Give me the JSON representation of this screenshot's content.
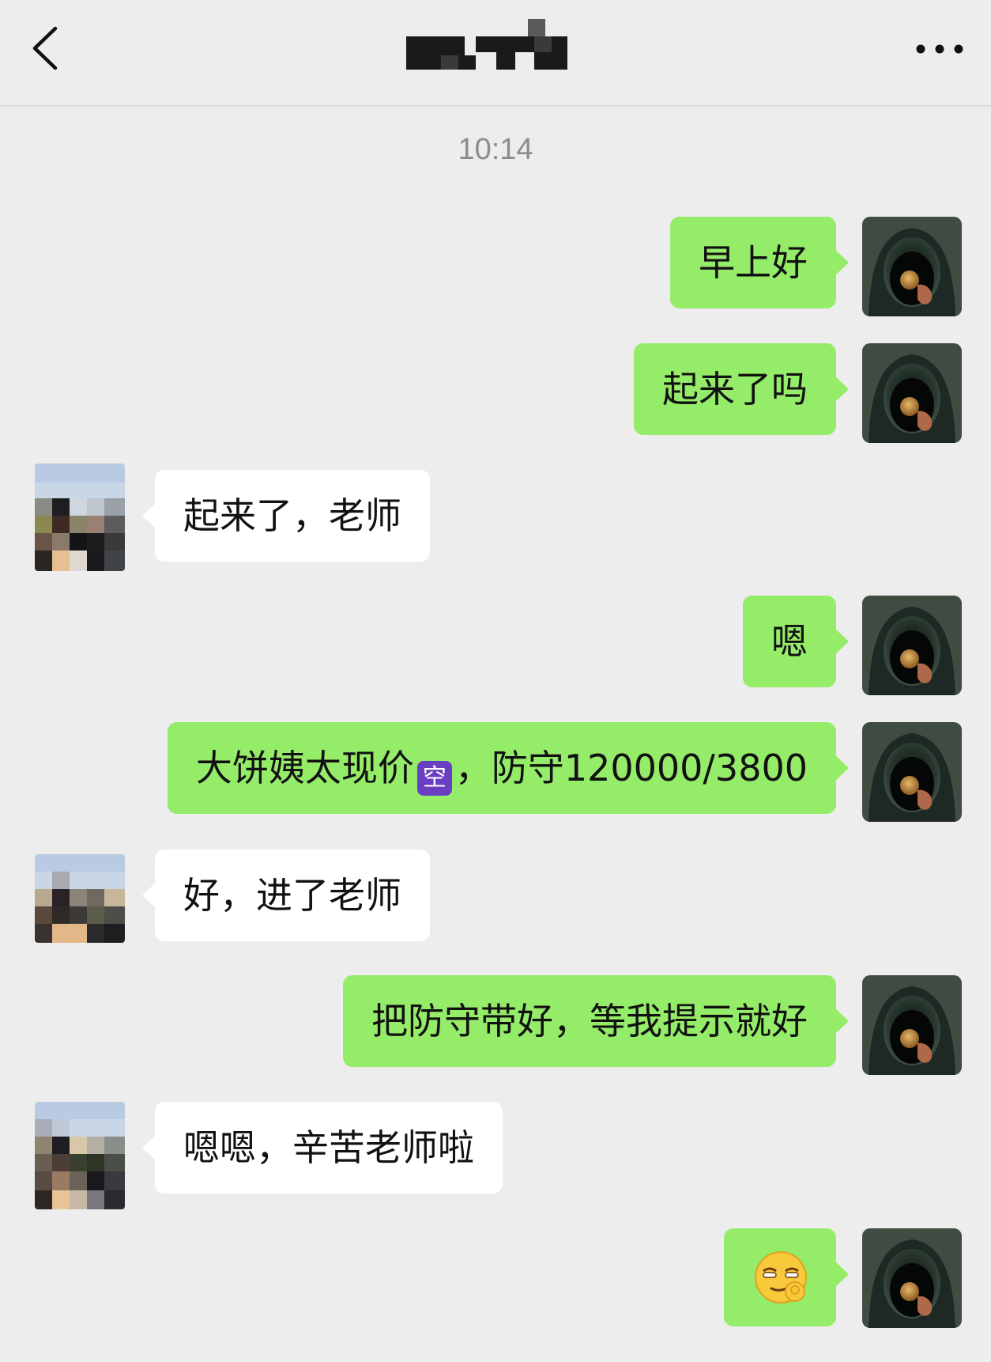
{
  "header": {
    "title_hidden": true
  },
  "chat": {
    "timestamp": "10:14",
    "messages": [
      {
        "side": "self",
        "text": "早上好"
      },
      {
        "side": "self",
        "text": "起来了吗"
      },
      {
        "side": "other",
        "text": "起来了，老师"
      },
      {
        "side": "self",
        "text": "嗯"
      },
      {
        "side": "self",
        "text_before": "大饼姨太现价",
        "badge": "空",
        "text_after": "，防守120000/3800"
      },
      {
        "side": "other",
        "text": "好，进了老师"
      },
      {
        "side": "self",
        "text": "把防守带好，等我提示就好"
      },
      {
        "side": "other",
        "text": "嗯嗯，辛苦老师啦"
      },
      {
        "side": "self",
        "emoji": "smirk-ok-emoji"
      }
    ]
  },
  "colors": {
    "background": "#ededed",
    "self_bubble": "#95ec69",
    "other_bubble": "#ffffff",
    "timestamp": "#8c8c8c"
  }
}
